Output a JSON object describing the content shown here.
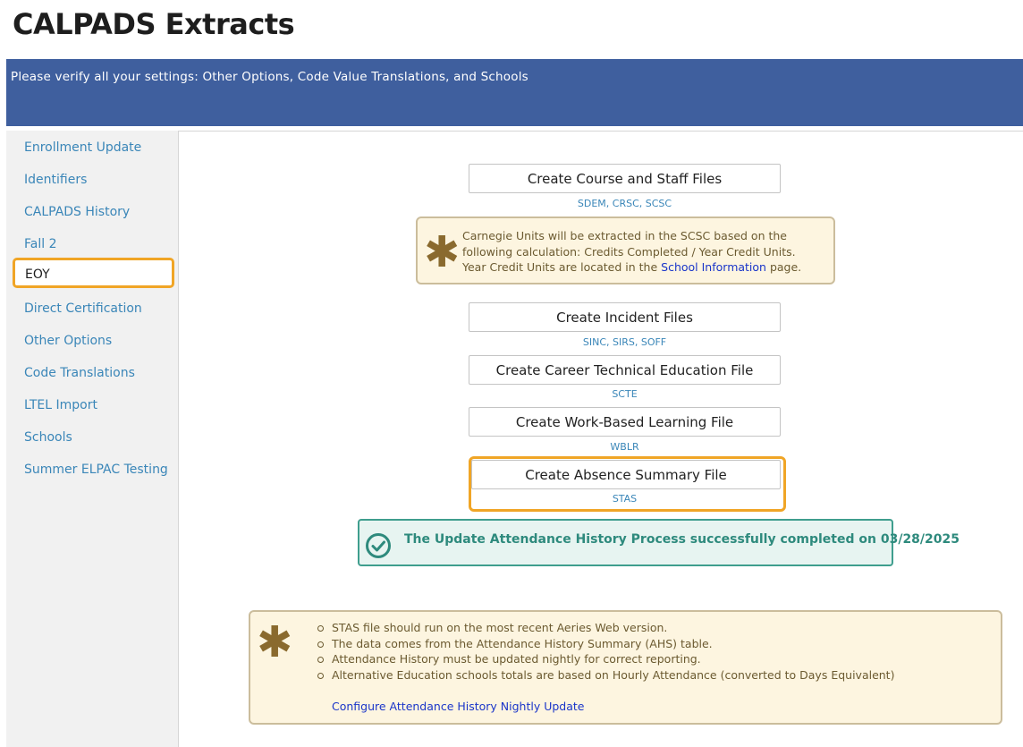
{
  "page": {
    "title": "CALPADS Extracts"
  },
  "banner": {
    "text": "Please verify all your settings: Other Options, Code Value Translations, and Schools"
  },
  "sidebar": {
    "items": [
      {
        "label": "Enrollment Update"
      },
      {
        "label": "Identifiers"
      },
      {
        "label": "CALPADS History"
      },
      {
        "label": "Fall 2"
      },
      {
        "label": "EOY",
        "active": true
      },
      {
        "label": "Direct Certification"
      },
      {
        "label": "Other Options"
      },
      {
        "label": "Code Translations"
      },
      {
        "label": "LTEL Import"
      },
      {
        "label": "Schools"
      },
      {
        "label": "Summer ELPAC Testing"
      }
    ]
  },
  "actions": [
    {
      "label": "Create Course and Staff Files",
      "files": "SDEM, CRSC, SCSC"
    },
    {
      "label": "Create Incident Files",
      "files": "SINC, SIRS, SOFF"
    },
    {
      "label": "Create Career Technical Education File",
      "files": "SCTE"
    },
    {
      "label": "Create Work-Based Learning File",
      "files": "WBLR"
    },
    {
      "label": "Create Absence Summary File",
      "files": "STAS"
    }
  ],
  "carnegie_note": {
    "line1": "Carnegie Units will be extracted in the SCSC based on the",
    "line2": "following calculation: Credits Completed / Year Credit Units.",
    "line3_prefix": "Year Credit Units are located in the ",
    "link": "School Information",
    "line3_suffix": " page."
  },
  "success": {
    "text": "The Update Attendance History Process successfully completed on 03/28/2025"
  },
  "stas_note": {
    "bullets": [
      "STAS file should run on the most recent Aeries Web version.",
      "The data comes from the Attendance History Summary (AHS) table.",
      "Attendance History must be updated nightly for correct reporting.",
      "Alternative Education schools totals are based on Hourly Attendance (converted to Days Equivalent)"
    ],
    "link": "Configure Attendance History Nightly Update"
  },
  "colors": {
    "banner": "#3f5f9e",
    "accent_highlight": "#f0a526",
    "link": "#3a86b8",
    "success": "#2e8a7d",
    "note_background": "#fdf5e0"
  },
  "icons": {
    "note": "asterisk-icon",
    "success": "check-circle-icon"
  }
}
